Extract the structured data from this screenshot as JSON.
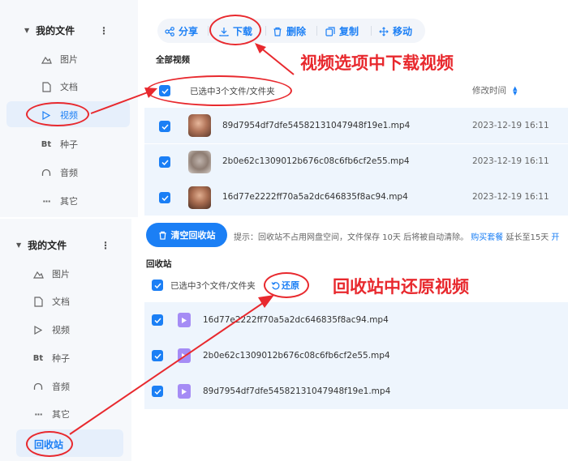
{
  "top_panel": {
    "sidebar": {
      "header": "我的文件",
      "items": [
        {
          "label": "图片",
          "icon": "image-icon"
        },
        {
          "label": "文档",
          "icon": "document-icon"
        },
        {
          "label": "视频",
          "icon": "play-icon"
        },
        {
          "label": "种子",
          "icon": "bt-icon",
          "glyph": "Bt"
        },
        {
          "label": "音频",
          "icon": "headphone-icon"
        },
        {
          "label": "其它",
          "icon": "more-icon"
        }
      ]
    },
    "toolbar": {
      "share": "分享",
      "download": "下载",
      "delete": "删除",
      "copy": "复制",
      "move": "移动"
    },
    "section_title": "全部视频",
    "selection_text": "已选中3个文件/文件夹",
    "column_modified": "修改时间",
    "files": [
      {
        "name": "89d7954df7dfe54582131047948f19e1.mp4",
        "date": "2023-12-19 16:11"
      },
      {
        "name": "2b0e62c1309012b676c08c6fb6cf2e55.mp4",
        "date": "2023-12-19 16:11"
      },
      {
        "name": "16d77e2222ff70a5a2dc646835f8ac94.mp4",
        "date": "2023-12-19 16:11"
      }
    ],
    "annotation": "视频选项中下载视频"
  },
  "bottom_panel": {
    "sidebar": {
      "header": "我的文件",
      "items": [
        {
          "label": "图片",
          "icon": "image-icon"
        },
        {
          "label": "文档",
          "icon": "document-icon"
        },
        {
          "label": "视频",
          "icon": "play-icon"
        },
        {
          "label": "种子",
          "icon": "bt-icon",
          "glyph": "Bt"
        },
        {
          "label": "音频",
          "icon": "headphone-icon"
        },
        {
          "label": "其它",
          "icon": "more-icon"
        }
      ],
      "recycle": "回收站"
    },
    "clear_button": "清空回收站",
    "tip_prefix": "提示：回收站不占用网盘空间，文件保存 10天 后将被自动清除。",
    "tip_link": "购买套餐",
    "tip_suffix": "延长至15天",
    "tip_link2": "开",
    "section_title": "回收站",
    "selection_text": "已选中3个文件/文件夹",
    "restore": "还原",
    "files": [
      {
        "name": "16d77e2222ff70a5a2dc646835f8ac94.mp4"
      },
      {
        "name": "2b0e62c1309012b676c08c6fb6cf2e55.mp4"
      },
      {
        "name": "89d7954df7dfe54582131047948f19e1.mp4"
      }
    ],
    "annotation": "回收站中还原视频"
  },
  "colors": {
    "accent": "#1b7ff5",
    "annotation_red": "#e8292e",
    "row_bg": "#eef5fd",
    "video_icon": "#a58cf5"
  }
}
